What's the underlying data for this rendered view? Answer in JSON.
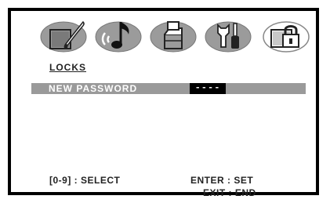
{
  "menu": {
    "icons": [
      {
        "name": "display-setup-icon",
        "selected": false
      },
      {
        "name": "audio-setup-icon",
        "selected": false
      },
      {
        "name": "system-setup-icon",
        "selected": false
      },
      {
        "name": "tools-setup-icon",
        "selected": false
      },
      {
        "name": "lock-icon",
        "selected": true
      }
    ]
  },
  "section": {
    "title": "LOCKS"
  },
  "password_row": {
    "label": "NEW PASSWORD",
    "value": "----"
  },
  "footer": {
    "select_hint": "[0-9] : SELECT",
    "enter_hint": "ENTER : SET",
    "exit_hint": "EXIT : END"
  },
  "colors": {
    "icon_fill": "#9b9b9b",
    "icon_selected_fill": "#ffffff",
    "row_highlight": "#9a9a9a",
    "field_background": "#000000"
  }
}
